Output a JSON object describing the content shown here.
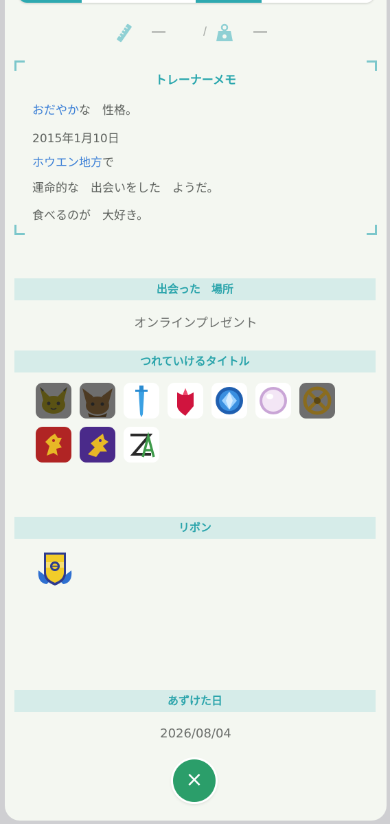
{
  "stats": {
    "height_value": "—",
    "separator": "/",
    "weight_value": "—"
  },
  "memo": {
    "title": "トレーナーメモ",
    "nature_highlight": "おだやか",
    "nature_rest": "な　性格。",
    "date": "2015年1月10日",
    "region_highlight": "ホウエン地方",
    "region_rest": "で",
    "met_line": "運命的な　出会いをした　ようだ。",
    "characteristic": "食べるのが　大好き。"
  },
  "met_location": {
    "header": "出会った　場所",
    "value": "オンラインプレゼント"
  },
  "titles": {
    "header": "つれていけるタイトル",
    "icons": [
      "lets-go-pikachu-icon",
      "lets-go-eevee-icon",
      "sword-icon",
      "shield-icon",
      "brilliant-diamond-icon",
      "shining-pearl-icon",
      "legends-arceus-icon",
      "scarlet-icon",
      "violet-icon",
      "legends-za-icon"
    ]
  },
  "ribbons": {
    "header": "リボン",
    "items": [
      "classic-ribbon-icon"
    ]
  },
  "deposit": {
    "header": "あずけた日",
    "date": "2026/08/04"
  },
  "close_button": {
    "label": "×"
  },
  "colors": {
    "accent": "#2aa4ab",
    "section_bg": "#d6ece9",
    "highlight_text": "#3b7fd6",
    "close_button": "#2b9e6a"
  }
}
